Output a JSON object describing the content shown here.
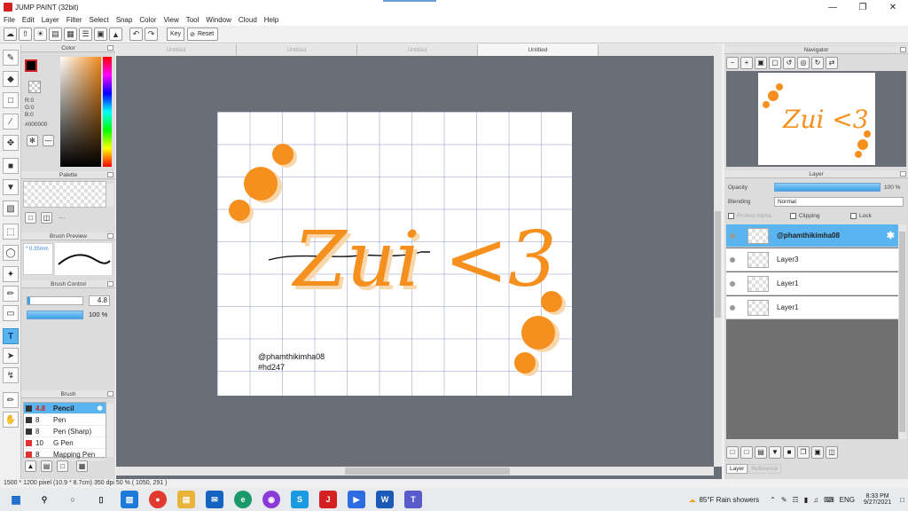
{
  "window": {
    "title": "JUMP PAINT (32bit)"
  },
  "menu": [
    "File",
    "Edit",
    "Layer",
    "Filter",
    "Select",
    "Snap",
    "Color",
    "View",
    "Tool",
    "Window",
    "Cloud",
    "Help"
  ],
  "toolbar": {
    "key_label": "Key",
    "reset_label": "Reset"
  },
  "panels": {
    "color": "Color",
    "palette": "Palette",
    "brush_preview": "Brush Preview",
    "brush_control": "Brush Control",
    "brush": "Brush",
    "navigator": "Navigator",
    "layer": "Layer"
  },
  "color": {
    "r": "R:0",
    "g": "G:0",
    "b": "B:0",
    "hex": "#000000",
    "fg": "#000000"
  },
  "palette": {
    "dots": "...."
  },
  "brush_preview": {
    "size": "* 0.35mm"
  },
  "brush_control": {
    "size": "4.8",
    "opacity": "100 %"
  },
  "brushes": [
    {
      "size": "4.8",
      "name": "Pencil",
      "color": "#333333"
    },
    {
      "size": "8",
      "name": "Pen",
      "color": "#333333"
    },
    {
      "size": "8",
      "name": "Pen (Sharp)",
      "color": "#333333"
    },
    {
      "size": "10",
      "name": "G Pen",
      "color": "#e03030"
    },
    {
      "size": "8",
      "name": "Mapping Pen",
      "color": "#e03030"
    }
  ],
  "tabs": [
    "Untitled",
    "Untitled",
    "Untitled",
    "Untitled"
  ],
  "artwork": {
    "title": "Zui <3",
    "handle": "@phamthikimha08",
    "tag": "#hd247",
    "accent": "#f5901e",
    "shadow": "#f8d7ad"
  },
  "layer_panel": {
    "opacity_label": "Opacity",
    "opacity_value": "100 %",
    "blending_label": "Blending",
    "blending_value": "Normal",
    "protect_alpha": "Protect Alpha",
    "clipping": "Clipping",
    "lock": "Lock"
  },
  "layers": [
    {
      "name": "@phamthikimha08"
    },
    {
      "name": "Layer3"
    },
    {
      "name": "Layer1"
    },
    {
      "name": "Layer1"
    }
  ],
  "right_tabs": {
    "layer": "Layer",
    "reference": "Reference"
  },
  "status": {
    "text": "1500 * 1200 pixel   (10.9 * 8.7cm)   350 dpi   50 %   ( 1050, 291 )"
  },
  "taskbar": {
    "weather": "85°F  Rain showers",
    "lang": "ENG",
    "time": "8:33 PM",
    "date": "9/27/2021"
  }
}
